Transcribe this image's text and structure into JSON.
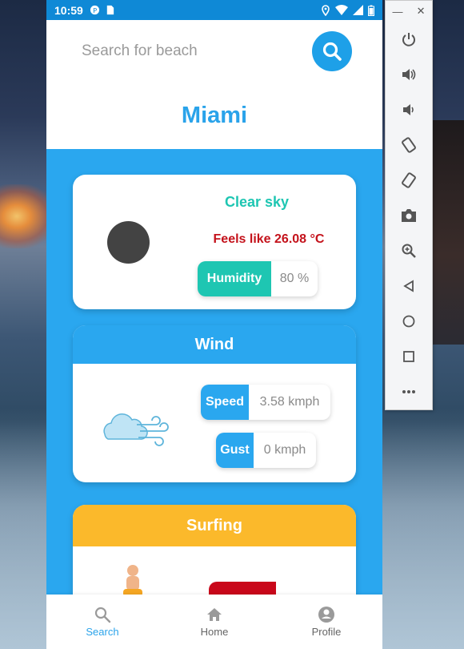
{
  "statusbar": {
    "time": "10:59"
  },
  "search": {
    "placeholder": "Search for beach"
  },
  "city": "Miami",
  "weather": {
    "description": "Clear sky",
    "feels_like": "Feels like 26.08 °C",
    "humidity_label": "Humidity",
    "humidity_value": "80 %"
  },
  "wind": {
    "title": "Wind",
    "speed_label": "Speed",
    "speed_value": "3.58 kmph",
    "gust_label": "Gust",
    "gust_value": "0 kmph"
  },
  "surfing": {
    "title": "Surfing"
  },
  "nav": [
    {
      "label": "Search",
      "icon": "search-icon",
      "active": true
    },
    {
      "label": "Home",
      "icon": "home-icon",
      "active": false
    },
    {
      "label": "Profile",
      "icon": "profile-icon",
      "active": false
    }
  ],
  "emulator_toolbar": {
    "buttons": [
      "power-icon",
      "volume-up-icon",
      "volume-down-icon",
      "rotate-left-icon",
      "rotate-right-icon",
      "camera-icon",
      "zoom-icon",
      "back-icon",
      "home-circle-icon",
      "overview-icon",
      "more-icon"
    ]
  },
  "colors": {
    "primary": "#2aa7ef",
    "teal": "#1ec6b2",
    "red": "#c4121b",
    "surfing": "#fbb92b"
  }
}
